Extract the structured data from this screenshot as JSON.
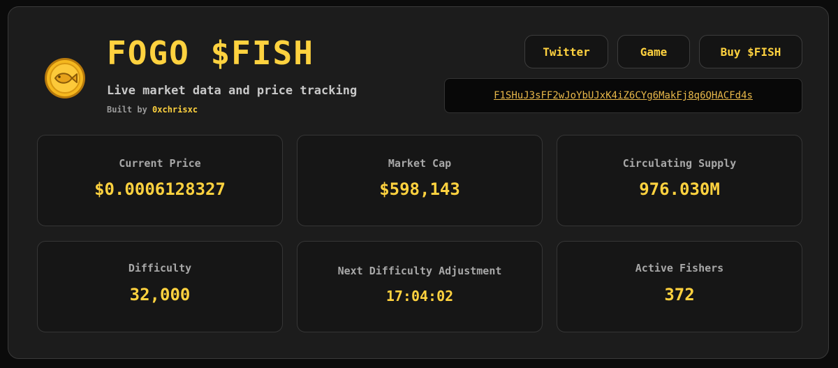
{
  "header": {
    "title": "FOGO $FISH",
    "subtitle": "Live market data and price tracking",
    "built_by_prefix": "Built by",
    "built_by_author": "0xchrisxc",
    "logo_icon": "fish-coin-icon"
  },
  "nav": {
    "twitter_label": "Twitter",
    "game_label": "Game",
    "buy_label": "Buy $FISH"
  },
  "contract": {
    "address": "F1SHuJ3sFF2wJoYbUJxK4iZ6CYg6MakFj8q6QHACFd4s"
  },
  "stats": [
    {
      "label": "Current Price",
      "value": "$0.0006128327"
    },
    {
      "label": "Market Cap",
      "value": "$598,143"
    },
    {
      "label": "Circulating Supply",
      "value": "976.030M"
    },
    {
      "label": "Difficulty",
      "value": "32,000"
    },
    {
      "label": "Next Difficulty Adjustment",
      "value": "17:04:02"
    },
    {
      "label": "Active Fishers",
      "value": "372"
    }
  ],
  "colors": {
    "accent": "#ffd23f",
    "background": "#0b0b0b",
    "card": "#1c1c1c",
    "muted_text": "#a8a8a8"
  }
}
